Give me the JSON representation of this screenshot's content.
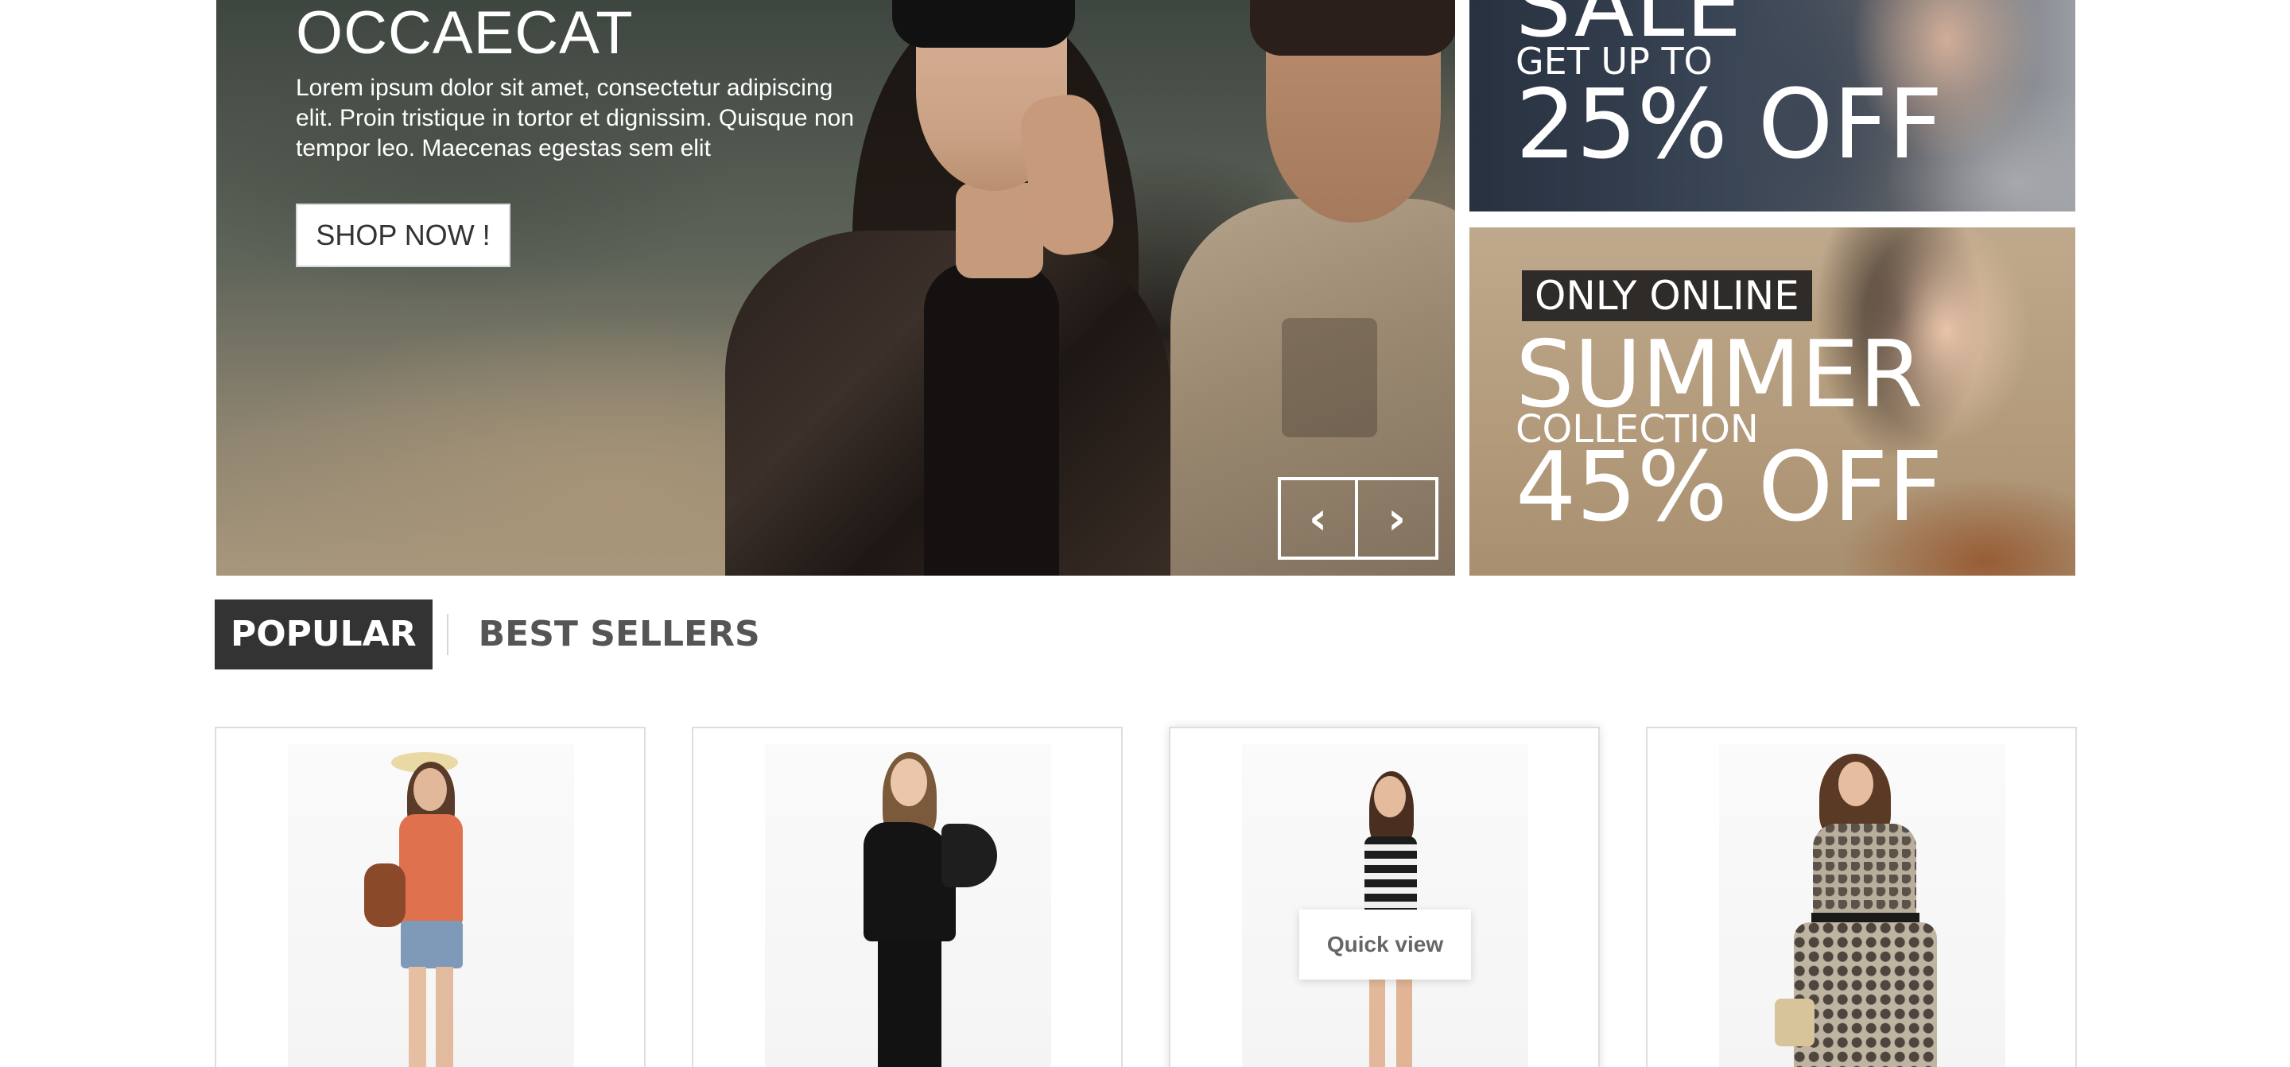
{
  "hero": {
    "title": "OCCAECAT",
    "text": "Lorem ipsum dolor sit amet, consectetur adipiscing elit. Proin tristique in tortor et dignissim. Quisque non tempor leo. Maecenas egestas sem elit",
    "button_label": "SHOP NOW !",
    "prev_icon": "chevron-left-icon",
    "next_icon": "chevron-right-icon",
    "prev_glyph": "‹",
    "next_glyph": "›"
  },
  "banners": {
    "top": {
      "headline": "SALE",
      "subline": "GET UP TO",
      "discount": "25% OFF"
    },
    "bottom": {
      "badge": "ONLY ONLINE",
      "headline": "SUMMER",
      "subline": "COLLECTION",
      "discount": "45% OFF"
    }
  },
  "tabs": [
    {
      "label": "POPULAR",
      "active": true
    },
    {
      "label": "BEST SELLERS",
      "active": false
    }
  ],
  "products": {
    "quick_view_label": "Quick view"
  },
  "colors": {
    "tab_active_bg": "#333333",
    "card_border": "#dedede",
    "banner_badge_bg": "#2e2b29"
  }
}
